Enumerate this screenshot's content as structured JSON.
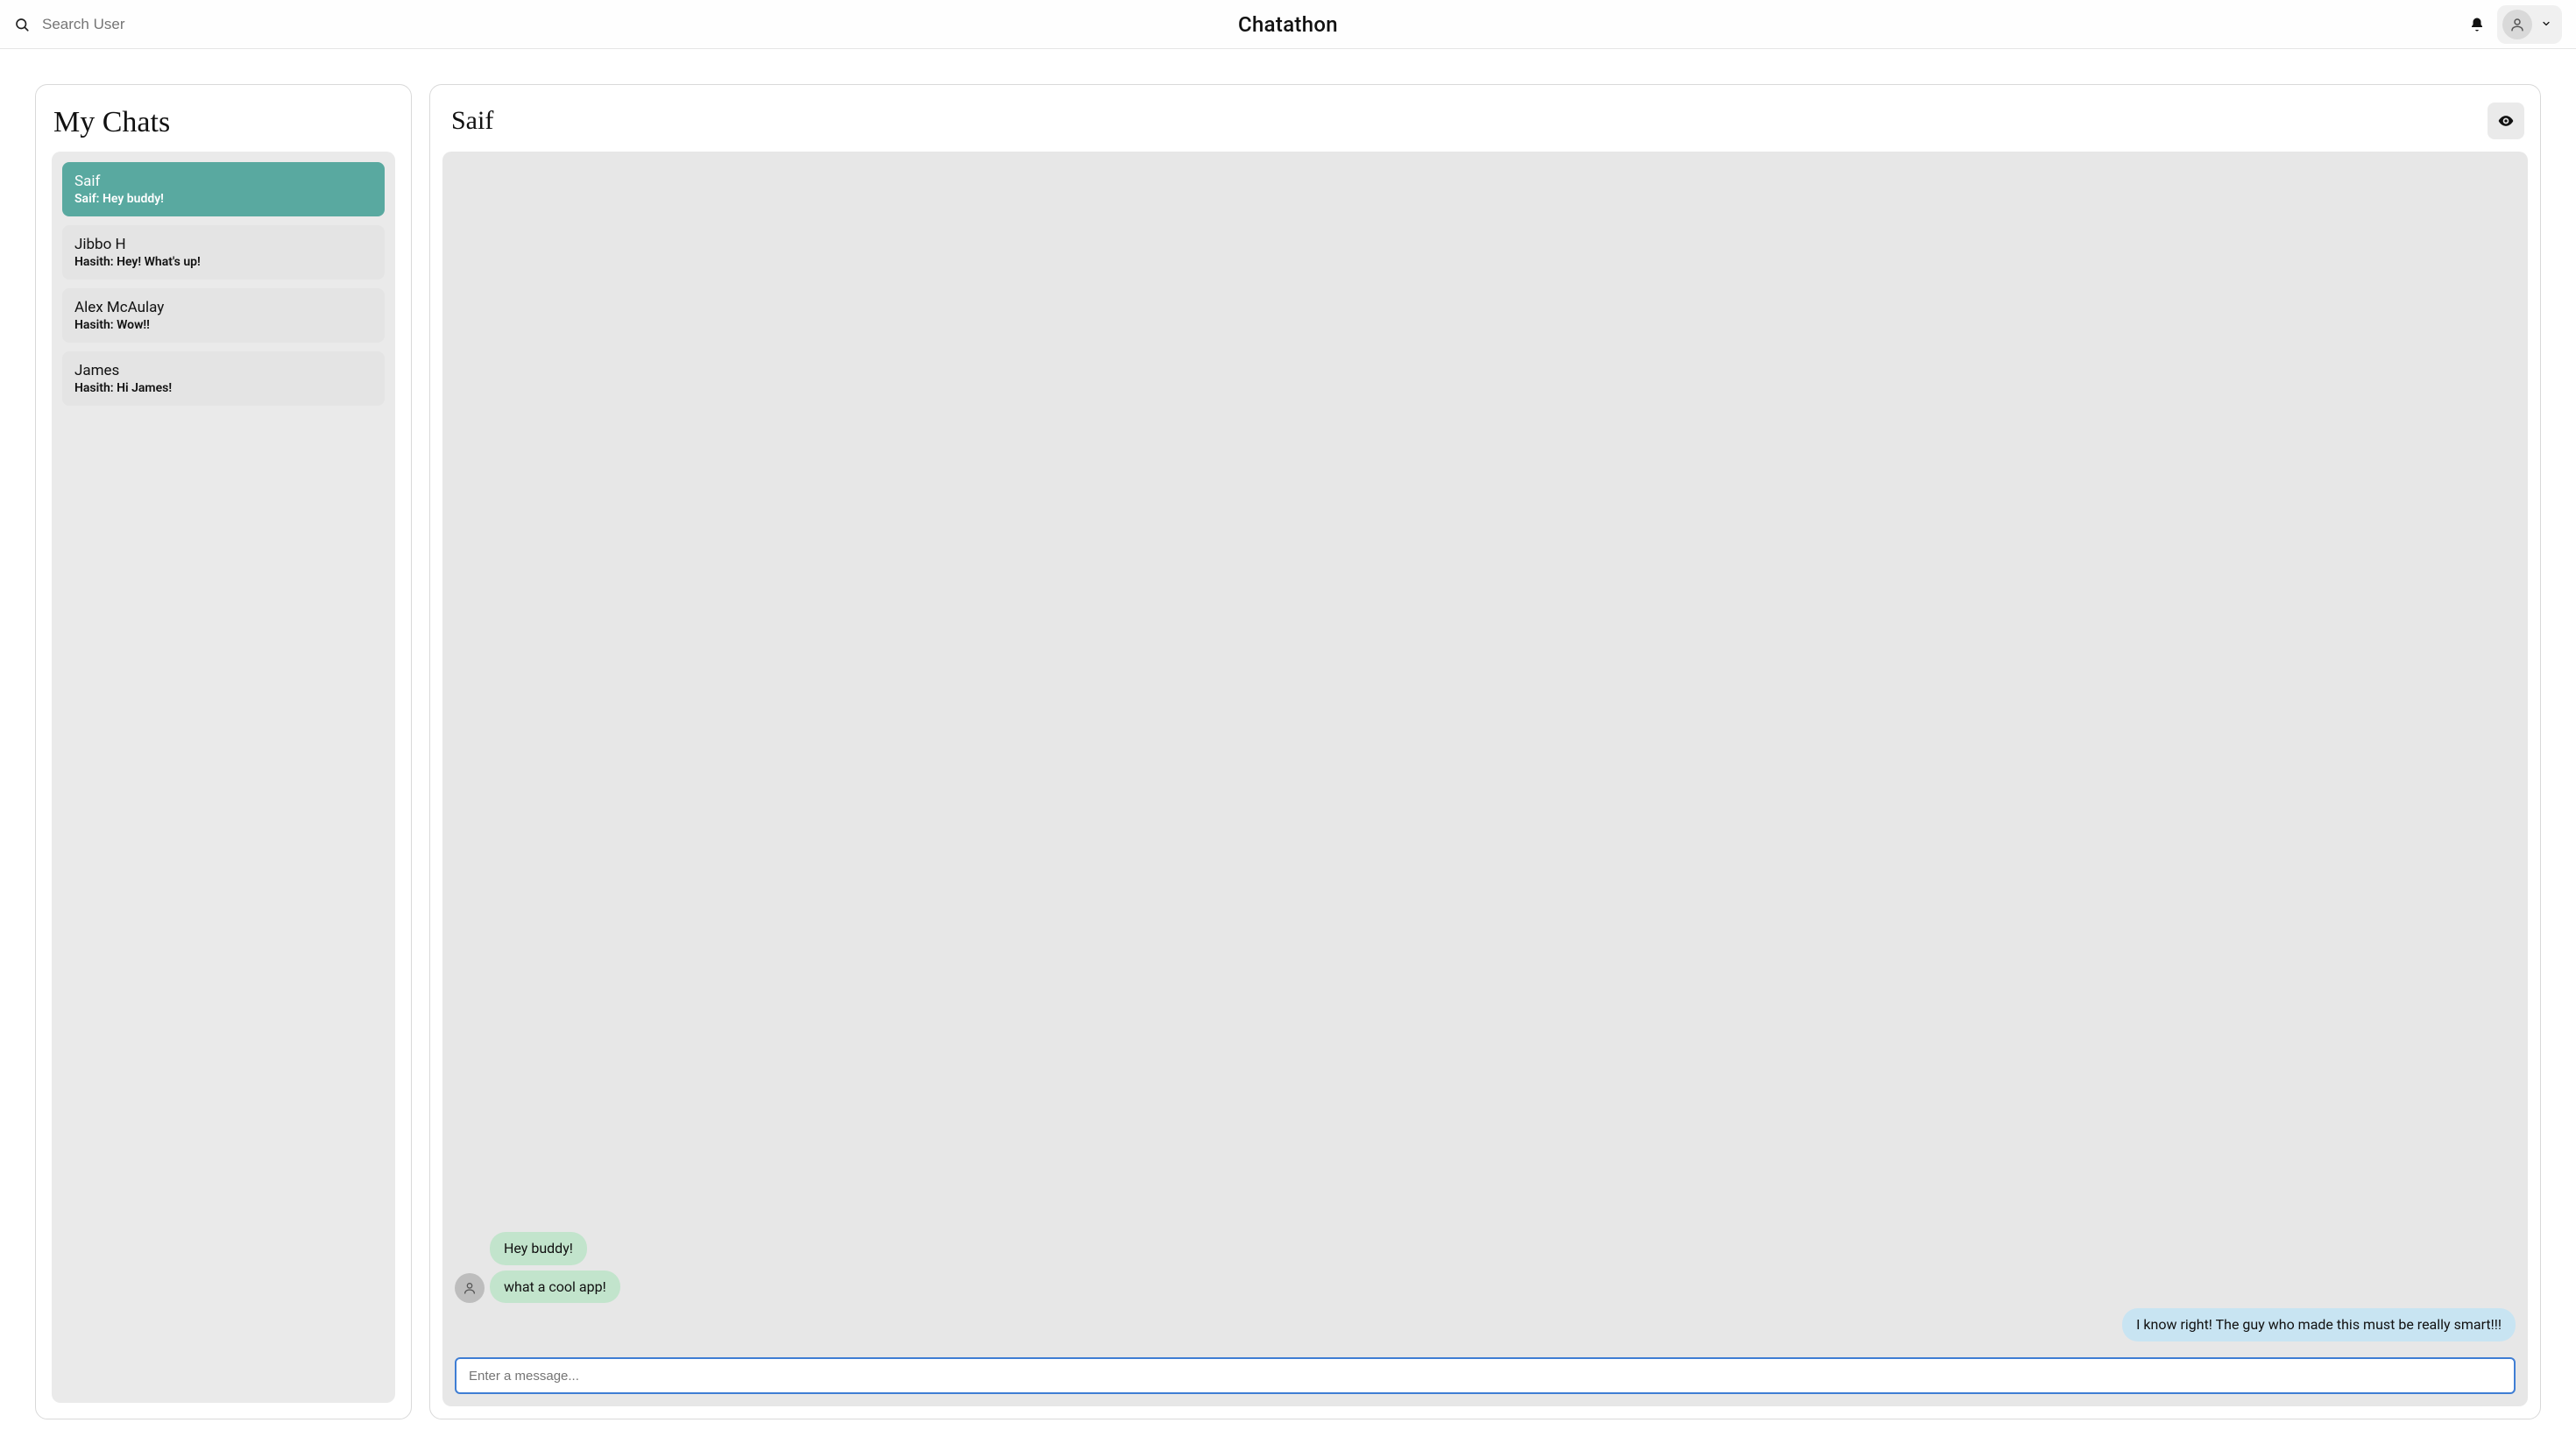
{
  "header": {
    "app_title": "Chatathon",
    "search_placeholder": "Search User"
  },
  "sidebar": {
    "title": "My Chats",
    "chats": [
      {
        "name": "Saif",
        "preview": "Saif: Hey buddy!",
        "active": true
      },
      {
        "name": "Jibbo H",
        "preview": "Hasith: Hey! What's up!",
        "active": false
      },
      {
        "name": "Alex McAulay",
        "preview": "Hasith: Wow!!",
        "active": false
      },
      {
        "name": "James",
        "preview": "Hasith: Hi James!",
        "active": false
      }
    ]
  },
  "conversation": {
    "with": "Saif",
    "messages": [
      {
        "from": "other",
        "text": "Hey buddy!",
        "show_avatar": false
      },
      {
        "from": "other",
        "text": "what a cool app!",
        "show_avatar": true
      },
      {
        "from": "me",
        "text": "I know right! The guy who made this must be really smart!!!",
        "show_avatar": false
      }
    ],
    "composer_placeholder": "Enter a message..."
  }
}
